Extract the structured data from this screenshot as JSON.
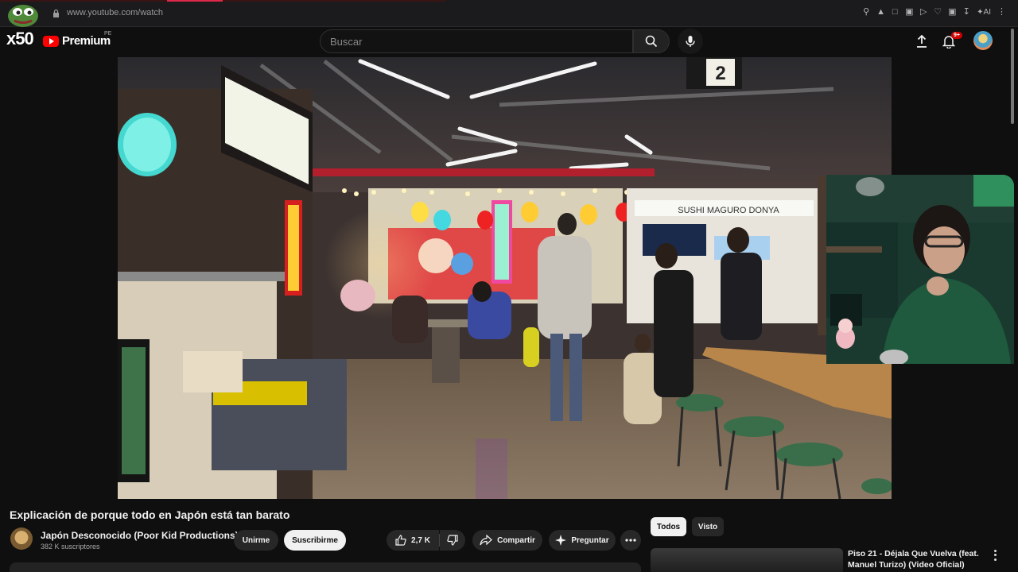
{
  "browser": {
    "url": "www.youtube.com/watch"
  },
  "overlay": {
    "badge_text": "x50"
  },
  "header": {
    "logo_text": "Premium",
    "region": "PE",
    "search_placeholder": "Buscar",
    "notifications_count": "9+"
  },
  "video": {
    "title": "Explicación de porque todo en Japón está tan barato",
    "scene_text": {
      "sign_number": "2",
      "store_sign": "SUSHI MAGURO DONYA"
    }
  },
  "channel": {
    "name": "Japón Desconocido (Poor Kid Productions)",
    "subscribers": "382 K suscriptores",
    "join_label": "Unirme",
    "subscribe_label": "Suscribirme"
  },
  "actions": {
    "likes": "2,7 K",
    "share_label": "Compartir",
    "ask_label": "Preguntar"
  },
  "sidebar": {
    "chips": [
      "Todos",
      "Visto"
    ],
    "recommendation_title": "Piso 21 - Déjala Que Vuelva (feat. Manuel Turizo) (Video Oficial)"
  },
  "colors": {
    "brand_red": "#ff0000",
    "background": "#0f0f0f",
    "chip_active": "#f1f1f1"
  }
}
